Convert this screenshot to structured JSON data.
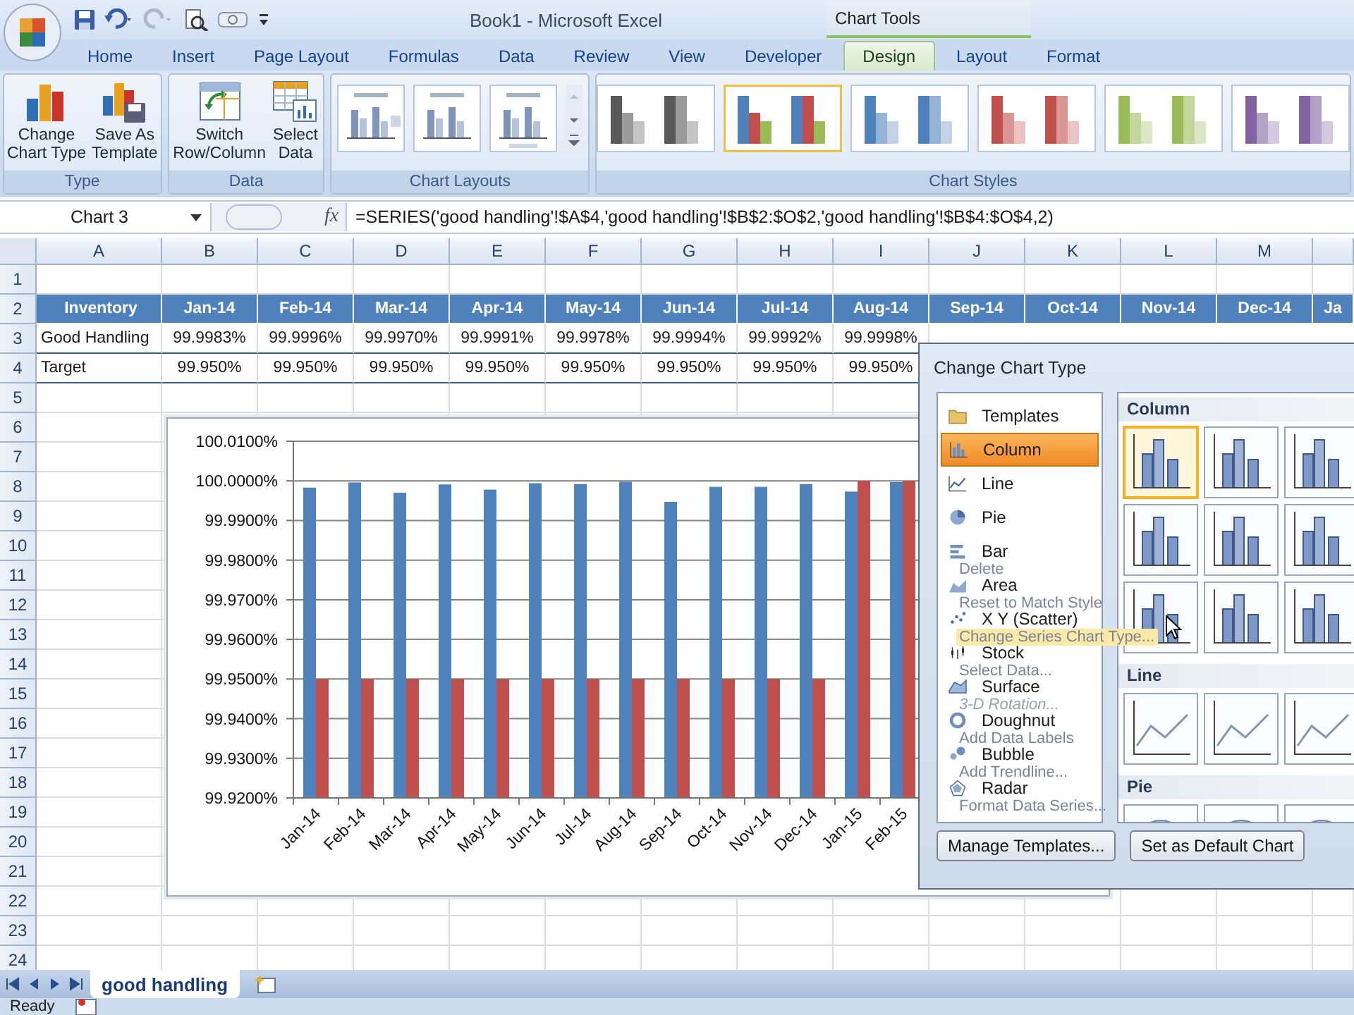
{
  "window": {
    "title": "Book1 - Microsoft Excel"
  },
  "context_tab_group": {
    "label": "Chart Tools"
  },
  "tabs": [
    {
      "label": "Home",
      "selected": false
    },
    {
      "label": "Insert",
      "selected": false
    },
    {
      "label": "Page Layout",
      "selected": false
    },
    {
      "label": "Formulas",
      "selected": false
    },
    {
      "label": "Data",
      "selected": false
    },
    {
      "label": "Review",
      "selected": false
    },
    {
      "label": "View",
      "selected": false
    },
    {
      "label": "Developer",
      "selected": false
    },
    {
      "label": "Design",
      "selected": true
    },
    {
      "label": "Layout",
      "selected": false
    },
    {
      "label": "Format",
      "selected": false
    }
  ],
  "ribbon": {
    "groups": [
      {
        "label": "Type",
        "kind": "buttons",
        "buttons": [
          {
            "lines": [
              "Change",
              "Chart Type"
            ],
            "kind": "change-type"
          },
          {
            "lines": [
              "Save As",
              "Template"
            ],
            "kind": "save-template"
          }
        ]
      },
      {
        "label": "Data",
        "kind": "buttons",
        "buttons": [
          {
            "lines": [
              "Switch",
              "Row/Column"
            ],
            "kind": "switch"
          },
          {
            "lines": [
              "Select",
              "Data"
            ],
            "kind": "select-data"
          }
        ]
      },
      {
        "label": "Chart Layouts",
        "kind": "layouts"
      },
      {
        "label": "Chart Styles",
        "kind": "styles",
        "styles": [
          {
            "kind": "mono",
            "color": "#595959",
            "selected": false
          },
          {
            "kind": "multi",
            "color": "#4f81bd",
            "selected": true
          },
          {
            "kind": "mono",
            "color": "#4f81bd",
            "selected": false
          },
          {
            "kind": "mono",
            "color": "#c0504d",
            "selected": false
          },
          {
            "kind": "mono",
            "color": "#9bbb59",
            "selected": false
          },
          {
            "kind": "mono",
            "color": "#8064a2",
            "selected": false
          }
        ]
      }
    ]
  },
  "formula_bar": {
    "name_box": "Chart 3",
    "fx_label": "fx",
    "formula": "=SERIES('good handling'!$A$4,'good handling'!$B$2:$O$2,'good handling'!$B$4:$O$4,2)"
  },
  "sheet": {
    "columns": [
      "A",
      "B",
      "C",
      "D",
      "E",
      "F",
      "G",
      "H",
      "I",
      "J",
      "K",
      "L",
      "M"
    ],
    "rows": [
      {
        "number": "1",
        "kind": "blank",
        "cells": []
      },
      {
        "number": "2",
        "kind": "header",
        "cells": [
          "Inventory",
          "Jan-14",
          "Feb-14",
          "Mar-14",
          "Apr-14",
          "May-14",
          "Jun-14",
          "Jul-14",
          "Aug-14",
          "Sep-14",
          "Oct-14",
          "Nov-14",
          "Dec-14",
          "Ja"
        ]
      },
      {
        "number": "3",
        "kind": "data",
        "cells": [
          "Good Handling",
          "99.9983%",
          "99.9996%",
          "99.9970%",
          "99.9991%",
          "99.9978%",
          "99.9994%",
          "99.9992%",
          "99.9998%"
        ]
      },
      {
        "number": "4",
        "kind": "data",
        "cells": [
          "Target",
          "99.950%",
          "99.950%",
          "99.950%",
          "99.950%",
          "99.950%",
          "99.950%",
          "99.950%",
          "99.950%"
        ]
      },
      {
        "number": "5",
        "kind": "blank",
        "cells": []
      },
      {
        "number": "6",
        "kind": "blank",
        "cells": []
      },
      {
        "number": "7",
        "kind": "blank",
        "cells": []
      },
      {
        "number": "8",
        "kind": "blank",
        "cells": []
      },
      {
        "number": "9",
        "kind": "blank",
        "cells": []
      },
      {
        "number": "10",
        "kind": "blank",
        "cells": []
      },
      {
        "number": "11",
        "kind": "blank",
        "cells": []
      },
      {
        "number": "12",
        "kind": "blank",
        "cells": []
      },
      {
        "number": "13",
        "kind": "blank",
        "cells": []
      },
      {
        "number": "14",
        "kind": "blank",
        "cells": []
      },
      {
        "number": "15",
        "kind": "blank",
        "cells": []
      },
      {
        "number": "16",
        "kind": "blank",
        "cells": []
      },
      {
        "number": "17",
        "kind": "blank",
        "cells": []
      },
      {
        "number": "18",
        "kind": "blank",
        "cells": []
      },
      {
        "number": "19",
        "kind": "blank",
        "cells": []
      },
      {
        "number": "20",
        "kind": "blank",
        "cells": []
      },
      {
        "number": "21",
        "kind": "blank",
        "cells": []
      },
      {
        "number": "22",
        "kind": "blank",
        "cells": []
      },
      {
        "number": "23",
        "kind": "blank",
        "cells": []
      },
      {
        "number": "24",
        "kind": "blank",
        "cells": []
      }
    ]
  },
  "chart": {
    "chart_data": {
      "type": "bar",
      "categories": [
        "Jan-14",
        "Feb-14",
        "Mar-14",
        "Apr-14",
        "May-14",
        "Jun-14",
        "Jul-14",
        "Aug-14",
        "Sep-14",
        "Oct-14",
        "Nov-14",
        "Dec-14",
        "Jan-15",
        "Feb-15"
      ],
      "series": [
        {
          "color": "#4f81bd",
          "values": [
            99.9983,
            99.9996,
            99.997,
            99.9991,
            99.9978,
            99.9994,
            99.9992,
            99.9998,
            99.9947,
            99.9985,
            99.9985,
            99.9992,
            99.9973,
            99.9997
          ]
        },
        {
          "color": "#c0504d",
          "values": [
            99.95,
            99.95,
            99.95,
            99.95,
            99.95,
            99.95,
            99.95,
            99.95,
            99.95,
            99.95,
            99.95,
            99.95,
            100,
            100
          ]
        }
      ],
      "ylim": [
        99.92,
        100.01
      ],
      "grid": true,
      "yticks": [
        {
          "value": 99.92,
          "label": "99.9200%"
        },
        {
          "value": 99.93,
          "label": "99.9300%"
        },
        {
          "value": 99.94,
          "label": "99.9400%"
        },
        {
          "value": 99.95,
          "label": "99.9500%"
        },
        {
          "value": 99.96,
          "label": "99.9600%"
        },
        {
          "value": 99.97,
          "label": "99.9700%"
        },
        {
          "value": 99.98,
          "label": "99.9800%"
        },
        {
          "value": 99.99,
          "label": "99.9900%"
        },
        {
          "value": 100,
          "label": "100.0000%"
        },
        {
          "value": 100.01,
          "label": "100.0100%"
        }
      ]
    }
  },
  "dialog": {
    "title": "Change Chart Type",
    "chart_types": [
      {
        "label": "Templates",
        "kind": "templates",
        "selected": false
      },
      {
        "label": "Column",
        "kind": "column",
        "selected": true
      },
      {
        "label": "Line",
        "kind": "line",
        "selected": false
      },
      {
        "label": "Pie",
        "kind": "pie",
        "selected": false
      },
      {
        "label": "Bar",
        "kind": "bar",
        "selected": false
      },
      {
        "label": "Area",
        "kind": "area",
        "selected": false
      },
      {
        "label": "X Y (Scatter)",
        "kind": "scatter",
        "selected": false
      },
      {
        "label": "Stock",
        "kind": "stock",
        "selected": false
      },
      {
        "label": "Surface",
        "kind": "surface",
        "selected": false
      },
      {
        "label": "Doughnut",
        "kind": "doughnut",
        "selected": false
      },
      {
        "label": "Bubble",
        "kind": "bubble",
        "selected": false
      },
      {
        "label": "Radar",
        "kind": "radar",
        "selected": false
      }
    ],
    "sections": [
      {
        "title": "Column",
        "kind": "column",
        "subtypes": [
          {
            "selected": true
          },
          {
            "selected": false
          },
          {
            "selected": false
          },
          {
            "selected": false
          },
          {
            "selected": false
          },
          {
            "selected": false
          },
          {
            "selected": false
          },
          {
            "selected": false
          },
          {
            "selected": false
          }
        ]
      },
      {
        "title": "Line",
        "kind": "line",
        "subtypes": [
          {
            "selected": false
          },
          {
            "selected": false
          },
          {
            "selected": false
          }
        ]
      },
      {
        "title": "Pie",
        "kind": "pie",
        "subtypes": [
          {
            "selected": false
          },
          {
            "selected": false
          },
          {
            "selected": false
          }
        ]
      }
    ],
    "buttons": [
      "Manage Templates...",
      "Set as Default Chart"
    ]
  },
  "context_menu": {
    "items": [
      {
        "label": "Delete",
        "highlighted": false,
        "disabled": false
      },
      {
        "label": "Reset to Match Style",
        "highlighted": false,
        "disabled": false
      },
      {
        "label": "Change Series Chart Type...",
        "highlighted": true,
        "disabled": false
      },
      {
        "label": "Select Data...",
        "highlighted": false,
        "disabled": false
      },
      {
        "label": "3-D Rotation...",
        "highlighted": false,
        "disabled": true
      },
      {
        "label": "Add Data Labels",
        "highlighted": false,
        "disabled": false
      },
      {
        "label": "Add Trendline...",
        "highlighted": false,
        "disabled": false
      },
      {
        "label": "Format Data Series...",
        "highlighted": false,
        "disabled": false
      }
    ]
  },
  "sheet_tabs": [
    {
      "label": "good handling",
      "selected": true
    }
  ],
  "status_bar": {
    "text": "Ready"
  }
}
